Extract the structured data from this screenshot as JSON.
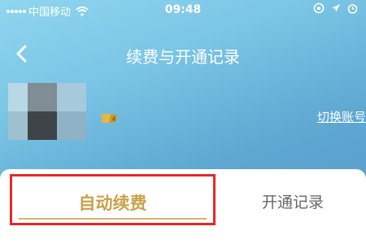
{
  "status_bar": {
    "carrier": "中国移动",
    "time": "09:48",
    "icons": [
      "signal-dots-icon",
      "wifi-icon",
      "location-icon",
      "alarm-icon",
      "lock-rotation-icon"
    ]
  },
  "nav": {
    "title": "续费与开通记录",
    "back_icon": "chevron-left-icon"
  },
  "profile": {
    "avatar_icon": "pixelated-avatar",
    "badge_icon": "vip-badge-icon",
    "switch_label": "切换账号"
  },
  "tabs": [
    {
      "label": "自动续费",
      "selected": true
    },
    {
      "label": "开通记录",
      "selected": false
    }
  ],
  "colors": {
    "hero_start": "#8fd6ee",
    "hero_end": "#5a9fcd",
    "selected_tab_text": "#c9a24a",
    "highlight_border": "#e5282b",
    "unselected_tab_text": "#666666"
  }
}
